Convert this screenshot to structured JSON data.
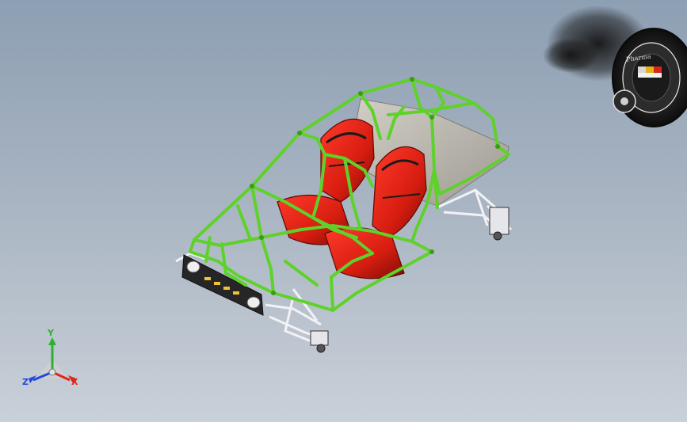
{
  "viewport": {
    "background_top": "#8d9fb3",
    "background_bottom": "#c9d0d8"
  },
  "model": {
    "frame_color": "#5ed22a",
    "seat_color": "#d71d10",
    "floor_color": "#b9b6ad",
    "suspension_color": "#e8e8ec",
    "bumper_color": "#2a2a2a"
  },
  "triad": {
    "x_label": "X",
    "y_label": "Y",
    "z_label": "Z",
    "x_color": "#e4231d",
    "y_color": "#2fb12f",
    "z_color": "#2449d8"
  },
  "spare_wheel": {
    "ring_text": "Pharma"
  }
}
